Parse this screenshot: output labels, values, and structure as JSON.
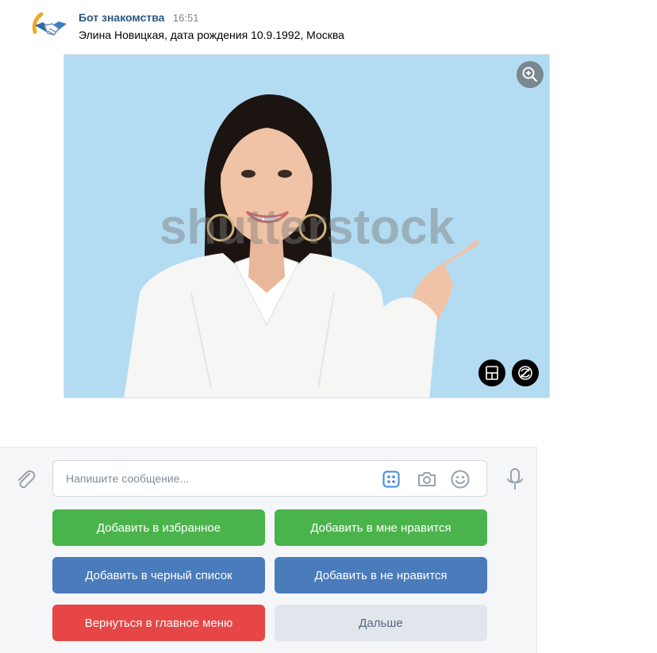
{
  "message": {
    "sender": "Бот знакомства",
    "time": "16:51",
    "text": "Элина Новицкая, дата рождения 10.9.1992, Москва",
    "avatar_icon": "handshake-icon",
    "photo": {
      "watermark": "shutterstock",
      "zoom_icon": "zoom-in-icon",
      "overlay_icons": [
        "scan-icon",
        "no-rotate-icon"
      ]
    }
  },
  "composer": {
    "placeholder": "Напишите сообщение...",
    "icons": [
      "paperclip-icon",
      "keyboard-icon",
      "camera-icon",
      "smile-icon",
      "microphone-icon"
    ]
  },
  "keyboard": {
    "add_favorite": "Добавить в избранное",
    "add_like": "Добавить в мне нравится",
    "add_blacklist": "Добавить в черный список",
    "add_dislike": "Добавить в не нравится",
    "back_main": "Вернуться в главное меню",
    "next": "Дальше"
  },
  "colors": {
    "green": "#4bb34b",
    "blue": "#4a7bbb",
    "red": "#e64646",
    "grey": "#e1e6ec",
    "link": "#2a5885",
    "photo_bg": "#b3dcf2"
  }
}
